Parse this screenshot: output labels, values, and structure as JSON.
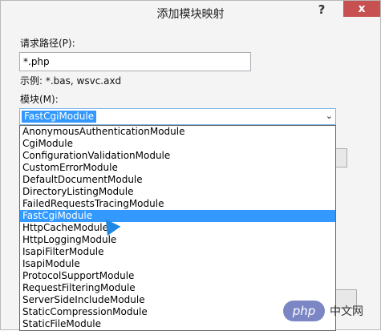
{
  "window": {
    "title": "添加模块映射",
    "help_glyph": "?",
    "close_glyph": "x"
  },
  "form": {
    "request_path_label": "请求路径(P):",
    "request_path_value": "*.php",
    "example_text": "示例: *.bas, wsvc.axd",
    "module_label": "模块(M):",
    "module_selected": "FastCgiModule",
    "dropdown_arrow_glyph": "⌄"
  },
  "dropdown": {
    "options": [
      "AnonymousAuthenticationModule",
      "CgiModule",
      "ConfigurationValidationModule",
      "CustomErrorModule",
      "DefaultDocumentModule",
      "DirectoryListingModule",
      "FailedRequestsTracingModule",
      "FastCgiModule",
      "HttpCacheModule",
      "HttpLoggingModule",
      "IsapiFilterModule",
      "IsapiModule",
      "ProtocolSupportModule",
      "RequestFilteringModule",
      "ServerSideIncludeModule",
      "StaticCompressionModule",
      "StaticFileModule"
    ],
    "selected_index": 7
  },
  "watermark": {
    "badge": "php",
    "text": "中文网"
  },
  "colors": {
    "selection": "#3399ff",
    "close_button": "#c75050",
    "window_bg": "#f4f4f4"
  }
}
